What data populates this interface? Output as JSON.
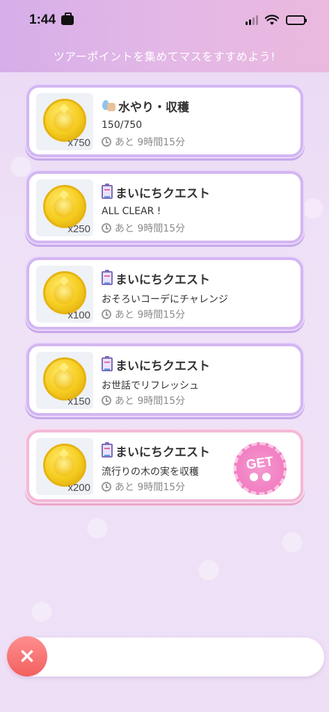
{
  "status_bar": {
    "time": "1:44"
  },
  "header": {
    "subtitle": "ツアーポイントを集めてマスをすすめよう!"
  },
  "cards": [
    {
      "quantity": "x750",
      "title": "水やり・収穫",
      "detail": "150/750",
      "time_label": "あと 9時間15分",
      "icon": "watering-icon"
    },
    {
      "quantity": "x250",
      "title": "まいにちクエスト",
      "detail": "ALL CLEAR !",
      "time_label": "あと 9時間15分",
      "icon": "clipboard-icon"
    },
    {
      "quantity": "x100",
      "title": "まいにちクエスト",
      "detail": "おそろいコーデにチャレンジ",
      "time_label": "あと 9時間15分",
      "icon": "clipboard-icon"
    },
    {
      "quantity": "x150",
      "title": "まいにちクエスト",
      "detail": "お世話でリフレッシュ",
      "time_label": "あと 9時間15分",
      "icon": "clipboard-icon"
    },
    {
      "quantity": "x200",
      "title": "まいにちクエスト",
      "detail": "流行りの木の実を収穫",
      "time_label": "あと 9時間15分",
      "icon": "clipboard-icon",
      "badge": "GET"
    }
  ],
  "bottom": {
    "close_symbol": "×"
  },
  "colors": {
    "card_border": "#d3b6f2",
    "card_border_highlight": "#f3b9d8",
    "get_badge": "#f27fc3",
    "close_button": "#f26060"
  }
}
